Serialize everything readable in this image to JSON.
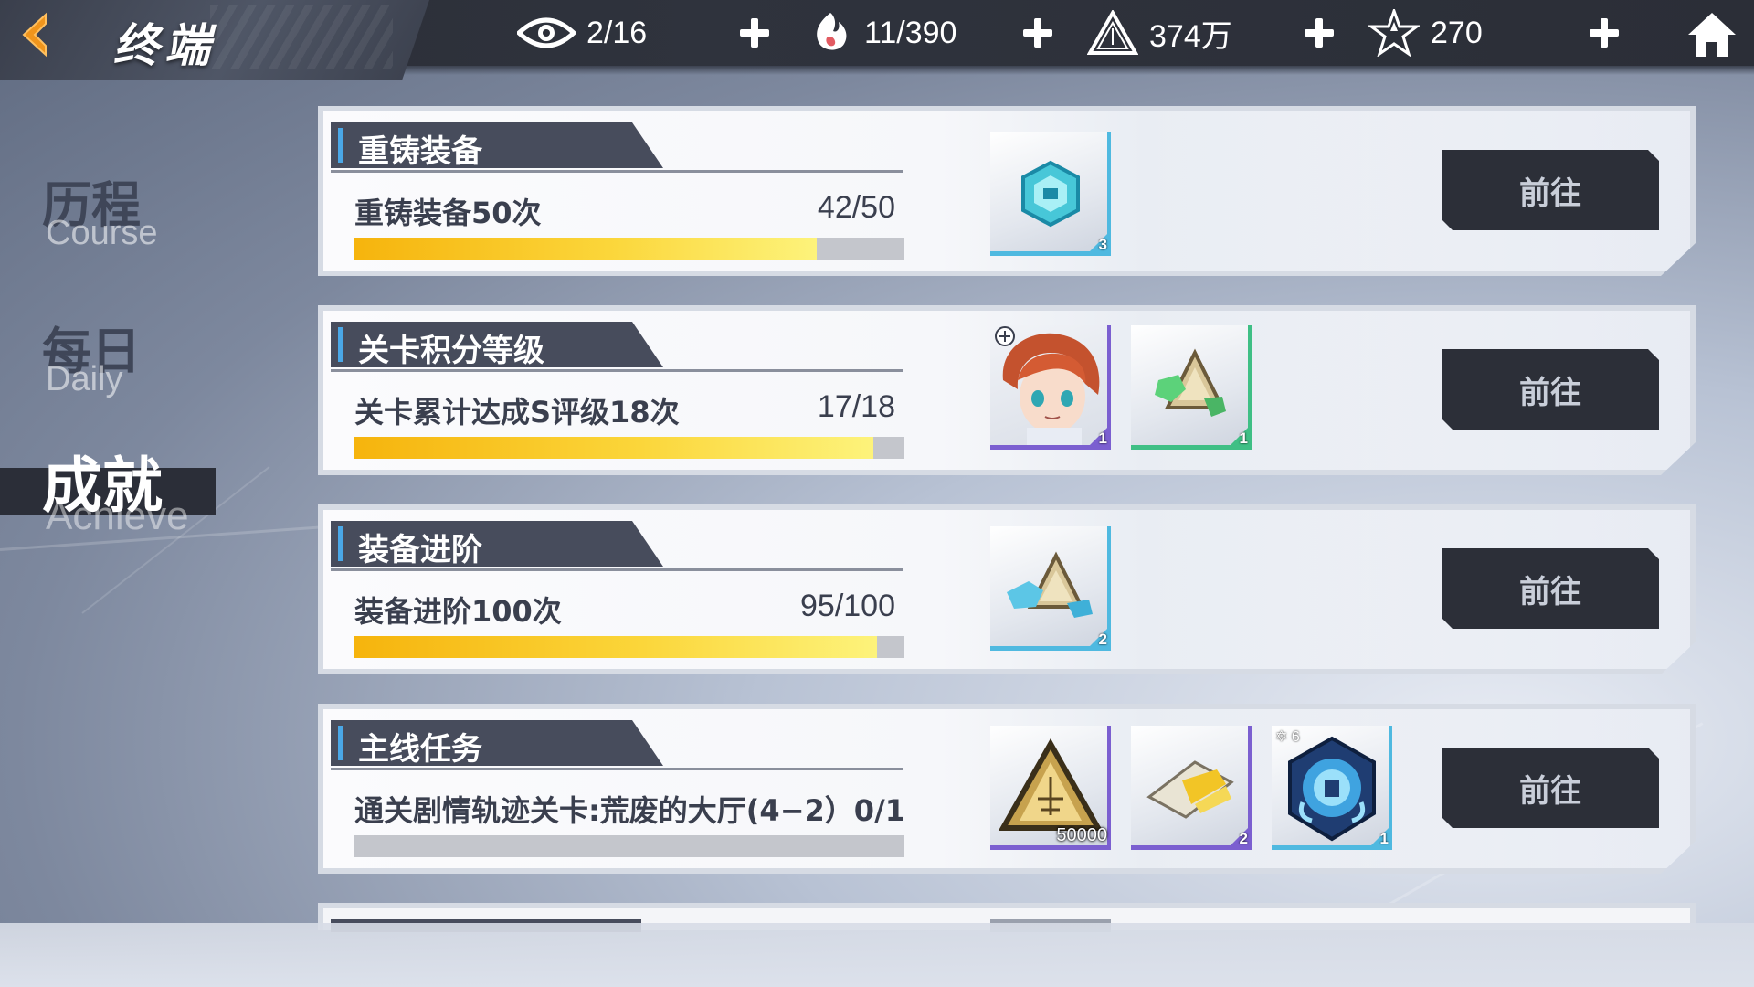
{
  "header": {
    "title": "终端",
    "back_icon": "back-arrow-icon",
    "home_icon": "home-icon"
  },
  "resources": [
    {
      "icon": "eye-icon",
      "value": "2/16"
    },
    {
      "icon": "flame-hand-icon",
      "value": "11/390"
    },
    {
      "icon": "triangle-coin-icon",
      "value": "374万"
    },
    {
      "icon": "star-crystal-icon",
      "value": "270"
    }
  ],
  "sidebar": {
    "items": [
      {
        "label": "历程",
        "sub": "Course",
        "active": false
      },
      {
        "label": "每日",
        "sub": "Daily",
        "active": false
      },
      {
        "label": "成就",
        "sub": "Achieve",
        "active": true
      }
    ]
  },
  "cards": [
    {
      "title": "重铸装备",
      "desc": "重铸装备50次",
      "count": "42/50",
      "progress": 0.84,
      "go_label": "前往",
      "rewards": [
        {
          "icon": "cyan-chip-icon",
          "qty": "3",
          "rarity_color": "#4fb9e0"
        }
      ]
    },
    {
      "title": "关卡积分等级",
      "desc": "关卡累计达成S评级18次",
      "count": "17/18",
      "progress": 0.944,
      "go_label": "前往",
      "rewards": [
        {
          "icon": "character-portrait-icon",
          "qty": "1",
          "rarity_color": "#7b5fd0"
        },
        {
          "icon": "green-crystal-triangle-icon",
          "qty": "1",
          "rarity_color": "#3fbf85"
        }
      ]
    },
    {
      "title": "装备进阶",
      "desc": "装备进阶100次",
      "count": "95/100",
      "progress": 0.95,
      "go_label": "前往",
      "rewards": [
        {
          "icon": "blue-crystal-triangle-icon",
          "qty": "2",
          "rarity_color": "#4fb9e0"
        }
      ]
    },
    {
      "title": "主线任务",
      "desc": "通关剧情轨迹关卡:荒废的大厅(4−2）0/1",
      "count": "",
      "progress": 0.0,
      "go_label": "前往",
      "rewards": [
        {
          "icon": "gold-triangle-coin-icon",
          "qty": "50000",
          "rarity_color": "#7b5fd0"
        },
        {
          "icon": "gold-ticket-icon",
          "qty": "2",
          "rarity_color": "#7b5fd0"
        },
        {
          "icon": "blue-shield-emblem-icon",
          "qty": "1",
          "rarity_color": "#4fb9e0",
          "star_badge": "6"
        }
      ]
    }
  ],
  "colors": {
    "topbar": "#2b2e37",
    "progress_fill": "#f8c51e",
    "button_bg": "#2c2f38",
    "header_bg": "#474c5c",
    "accent_blue": "#4aa7e6"
  }
}
